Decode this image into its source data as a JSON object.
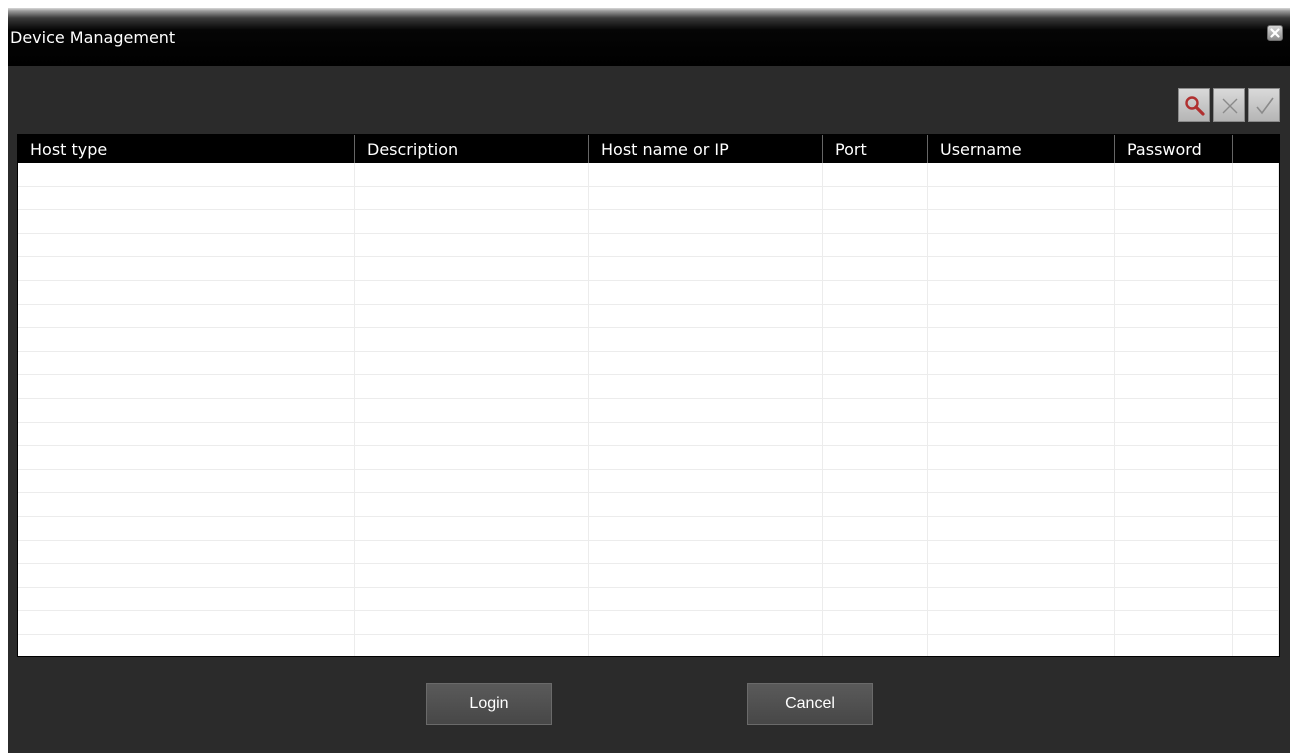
{
  "window": {
    "title": "Device Management",
    "close_icon": "close-icon"
  },
  "toolbar": {
    "buttons": [
      {
        "icon": "search-icon",
        "label": ""
      },
      {
        "icon": "delete-icon",
        "label": ""
      },
      {
        "icon": "confirm-icon",
        "label": ""
      }
    ]
  },
  "table": {
    "columns": [
      "Host type",
      "Description",
      "Host name or IP",
      "Port",
      "Username",
      "Password",
      ""
    ],
    "rows": []
  },
  "footer": {
    "login_label": "Login",
    "cancel_label": "Cancel"
  },
  "colors": {
    "dialog_background": "#2b2b2b",
    "title_background": "#000000",
    "header_background": "#000000",
    "button_background": "#4f4f4f",
    "search_icon_color": "#b03030"
  }
}
